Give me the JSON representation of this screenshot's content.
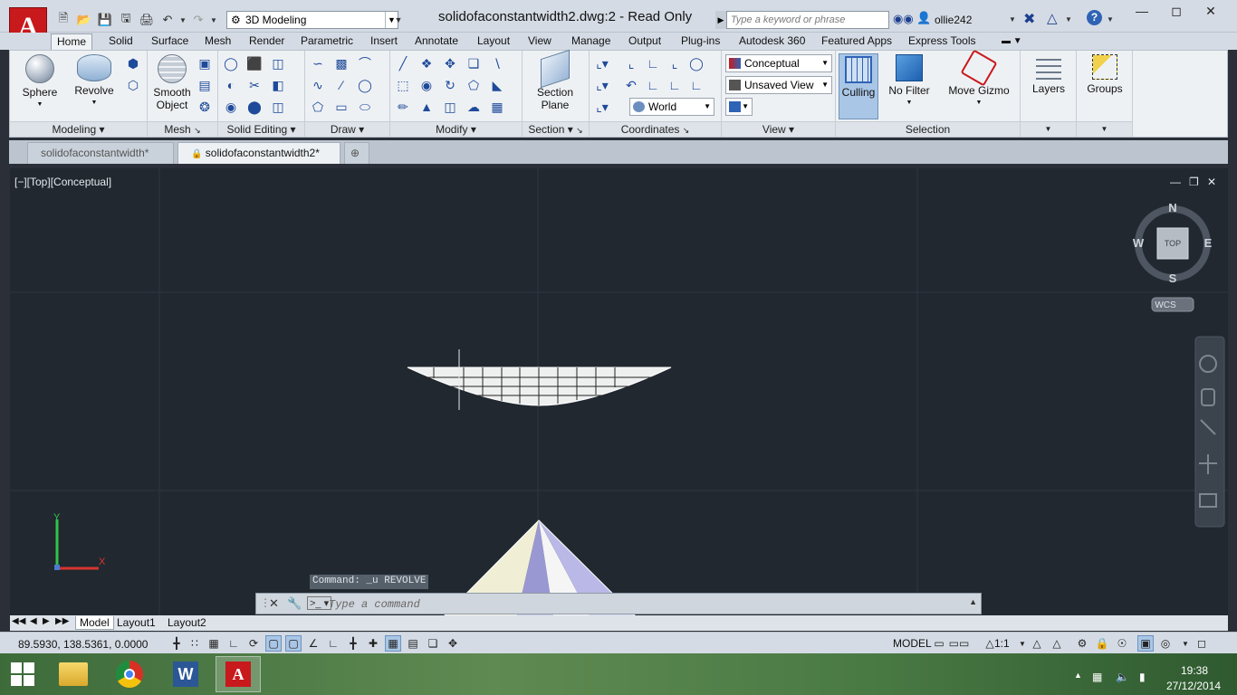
{
  "window": {
    "app_logo": "A",
    "workspace": "3D Modeling",
    "title": "solidofaconstantwidth2.dwg:2 - Read Only",
    "search_placeholder": "Type a keyword or phrase",
    "user": "ollie242"
  },
  "ribbon_tabs": [
    "Home",
    "Solid",
    "Surface",
    "Mesh",
    "Render",
    "Parametric",
    "Insert",
    "Annotate",
    "Layout",
    "View",
    "Manage",
    "Output",
    "Plug-ins",
    "Autodesk 360",
    "Featured Apps",
    "Express Tools"
  ],
  "panels": {
    "modeling": {
      "title": "Modeling",
      "sphere": "Sphere",
      "revolve": "Revolve"
    },
    "mesh": {
      "title": "Mesh",
      "smooth_line1": "Smooth",
      "smooth_line2": "Object"
    },
    "solid_editing": {
      "title": "Solid Editing"
    },
    "draw": {
      "title": "Draw"
    },
    "modify": {
      "title": "Modify"
    },
    "section": {
      "title": "Section",
      "plane_line1": "Section",
      "plane_line2": "Plane"
    },
    "coordinates": {
      "title": "Coordinates",
      "world": "World"
    },
    "view": {
      "title": "View",
      "visual_style": "Conceptual",
      "named_view": "Unsaved View"
    },
    "selection": {
      "title": "Selection",
      "culling": "Culling",
      "no_filter": "No Filter",
      "move_gizmo": "Move Gizmo"
    },
    "layers": {
      "label": "Layers"
    },
    "groups": {
      "label": "Groups"
    }
  },
  "doc_tabs": [
    "solidofaconstantwidth*",
    "solidofaconstantwidth2*"
  ],
  "viewport": {
    "label": "[−][Top][Conceptual]",
    "viewcube": {
      "top": "TOP",
      "n": "N",
      "s": "S",
      "e": "E",
      "w": "W",
      "wcs": "WCS"
    },
    "ucs": {
      "x": "X",
      "y": "Y"
    }
  },
  "command": {
    "history": "Command:  _u REVOLVE",
    "placeholder": "Type a command"
  },
  "layout_tabs": [
    "Model",
    "Layout1",
    "Layout2"
  ],
  "status": {
    "coords": "89.5930, 138.5361, 0.0000",
    "model": "MODEL",
    "scale": "1:1"
  },
  "taskbar": {
    "time": "19:38",
    "date": "27/12/2014"
  },
  "colors": {
    "accent": "#c8191c",
    "viewport_bg": "#212830",
    "selected": "#a9c6e6"
  }
}
